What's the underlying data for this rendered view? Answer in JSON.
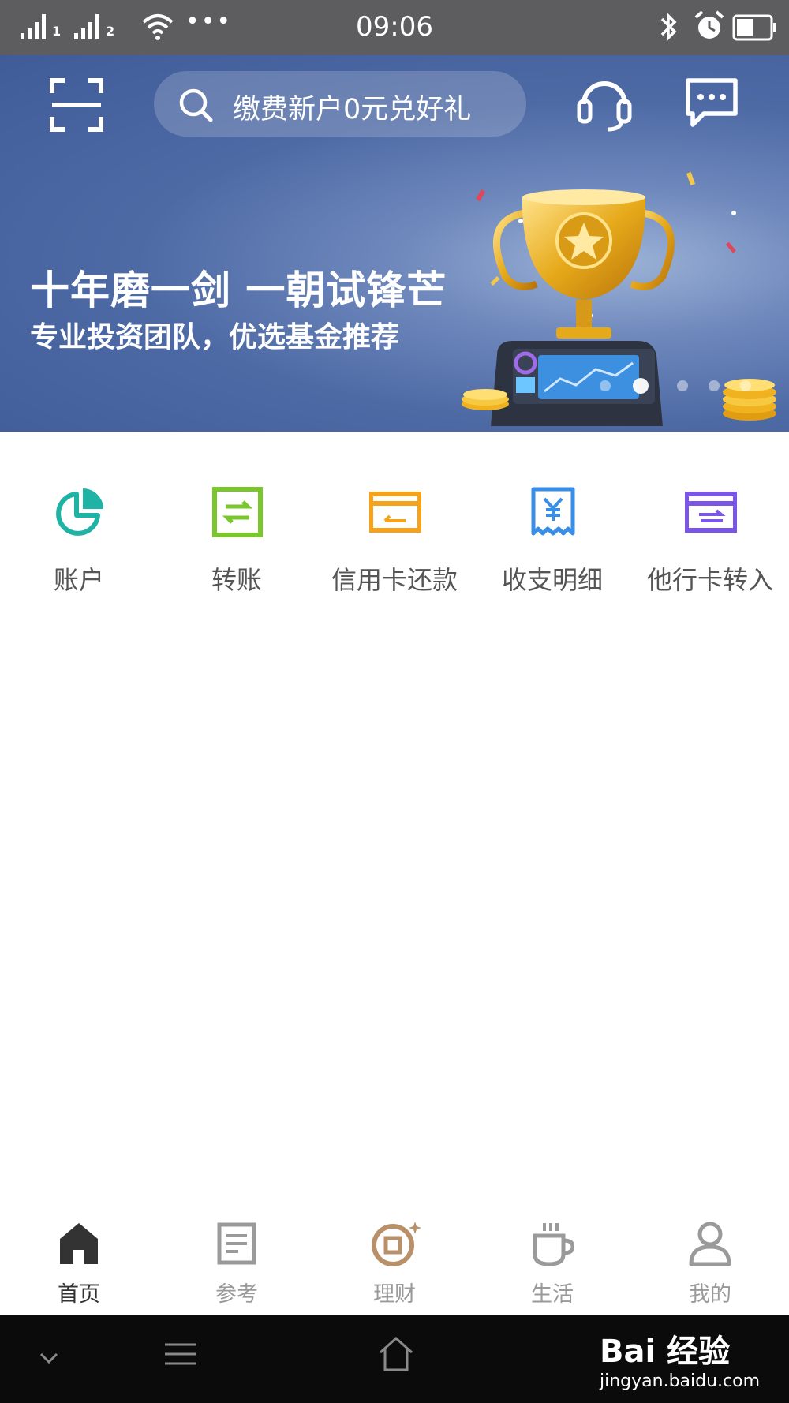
{
  "status_bar": {
    "time": "09:06",
    "sim1": "1",
    "sim2": "2",
    "more": "•••"
  },
  "header": {
    "search_placeholder": "缴费新户0元兑好礼"
  },
  "banner": {
    "headline": "十年磨一剑 一朝试锋芒",
    "subline": "专业投资团队，优选基金推荐",
    "carousel_total": 5,
    "carousel_active": 1
  },
  "quick_actions": [
    {
      "label": "账户",
      "icon": "pie-chart-icon",
      "color": "#1fb3a6"
    },
    {
      "label": "转账",
      "icon": "transfer-icon",
      "color": "#7ac62d"
    },
    {
      "label": "信用卡还款",
      "icon": "credit-card-icon",
      "color": "#f5a31a"
    },
    {
      "label": "收支明细",
      "icon": "receipt-yuan-icon",
      "color": "#3a8ee6"
    },
    {
      "label": "他行卡转入",
      "icon": "card-transfer-in-icon",
      "color": "#7a55e8"
    }
  ],
  "tabs": [
    {
      "label": "首页",
      "icon": "home-icon",
      "active": true
    },
    {
      "label": "参考",
      "icon": "document-icon",
      "active": false
    },
    {
      "label": "理财",
      "icon": "coin-icon",
      "active": false
    },
    {
      "label": "生活",
      "icon": "coffee-cup-icon",
      "active": false
    },
    {
      "label": "我的",
      "icon": "person-icon",
      "active": false
    }
  ],
  "watermark": {
    "logo": "Bai 经验",
    "url": "jingyan.baidu.com"
  }
}
